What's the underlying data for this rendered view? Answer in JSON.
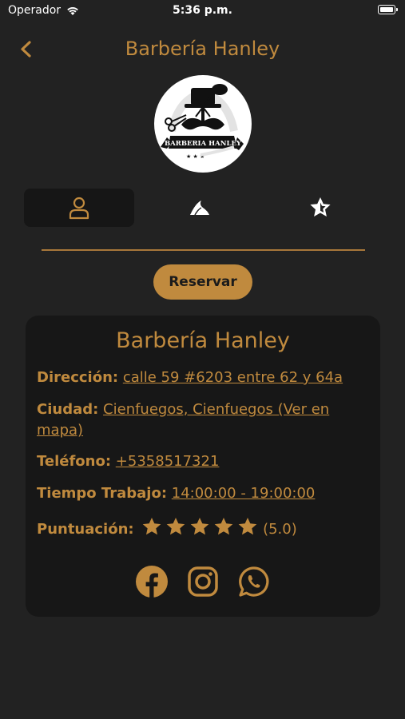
{
  "status_bar": {
    "carrier": "Operador",
    "time": "5:36 p.m."
  },
  "nav": {
    "title": "Barbería Hanley"
  },
  "logo": {
    "text": "BARBERIA HANLEY"
  },
  "tabs": [
    {
      "icon": "user-icon",
      "active": true
    },
    {
      "icon": "feed-icon",
      "active": false
    },
    {
      "icon": "star-icon",
      "active": false
    }
  ],
  "reserve_button": {
    "label": "Reservar"
  },
  "card": {
    "title": "Barbería Hanley",
    "address": {
      "label": "Dirección:",
      "value": "calle 59 #6203 entre 62 y 64a"
    },
    "city": {
      "label": "Ciudad:",
      "value": "Cienfuegos, Cienfuegos (Ver en mapa)"
    },
    "phone": {
      "label": "Teléfono:",
      "value": "+5358517321"
    },
    "hours": {
      "label": "Tiempo Trabajo:",
      "value": "14:00:00 - 19:00:00"
    },
    "rating": {
      "label": "Puntuación:",
      "stars": 5,
      "value": "(5.0)"
    },
    "socials": [
      "facebook-icon",
      "instagram-icon",
      "whatsapp-icon"
    ]
  },
  "colors": {
    "accent": "#c08a3e",
    "background": "#222222",
    "card": "#171717"
  }
}
